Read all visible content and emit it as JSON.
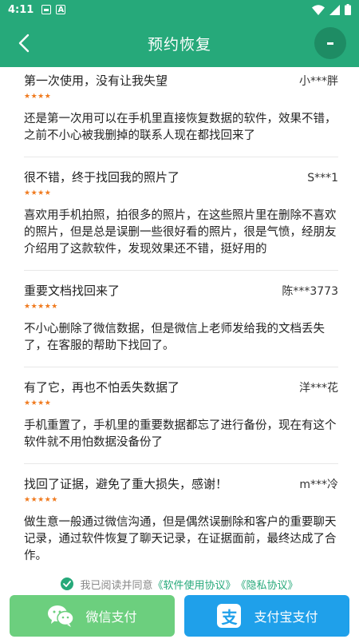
{
  "status_bar": {
    "time": "4:11"
  },
  "header": {
    "title": "预约恢复"
  },
  "reviews": [
    {
      "title": "第一次使用，没有让我失望",
      "user": "小***胖",
      "stars": "★★★★",
      "body": "还是第一次用可以在手机里直接恢复数据的软件，效果不错，之前不小心被我删掉的联系人现在都找回来了"
    },
    {
      "title": "很不错，终于找回我的照片了",
      "user": "S***1",
      "stars": "★★★★",
      "body": "喜欢用手机拍照，拍很多的照片，在这些照片里在删除不喜欢的照片，但是总是误删一些很好看的照片，很是气愤，经朋友介绍用了这款软件，发现效果还不错，挺好用的"
    },
    {
      "title": "重要文档找回来了",
      "user": "陈***3773",
      "stars": "★★★★★",
      "body": "不小心删除了微信数据，但是微信上老师发给我的文档丢失了，在客服的帮助下找回了。"
    },
    {
      "title": "有了它，再也不怕丢失数据了",
      "user": "洋***花",
      "stars": "★★★★",
      "body": "手机重置了，手机里的重要数据都忘了进行备份，现在有这个软件就不用怕数据没备份了"
    },
    {
      "title": "找回了证据，避免了重大损失，感谢！",
      "user": "m***冷",
      "stars": "★★★★★",
      "body": "做生意一般通过微信沟通，但是偶然误删除和客户的重要聊天记录，通过软件恢复了聊天记录，在证据面前，最终达成了合作。"
    }
  ],
  "agreement": {
    "prefix": "我已阅读并同意",
    "terms": "《软件使用协议》",
    "privacy": "《隐私协议》"
  },
  "payment": {
    "wechat_label": "微信支付",
    "alipay_label": "支付宝支付",
    "alipay_logo_char": "支"
  },
  "colors": {
    "primary": "#26a97a",
    "star": "#f07a1e",
    "wechat": "#6ccf7e",
    "alipay": "#1fa0ea"
  },
  "icons": [
    "back-arrow-icon",
    "menu-icon",
    "check-circle-icon",
    "wechat-icon",
    "alipay-icon"
  ]
}
